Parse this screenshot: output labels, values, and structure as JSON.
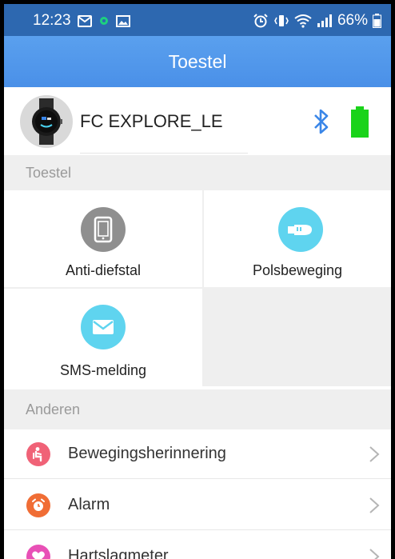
{
  "status_bar": {
    "time": "12:23",
    "battery_percent": "66%"
  },
  "header": {
    "title": "Toestel"
  },
  "device": {
    "name": "FC EXPLORE_LE",
    "bluetooth_icon": "bluetooth-icon",
    "battery_icon": "battery-full-icon",
    "connected_color": "#3a86e8",
    "battery_color": "#1ad31a"
  },
  "sections": {
    "device_label": "Toestel",
    "others_label": "Anderen"
  },
  "tiles": [
    {
      "label": "Anti-diefstal",
      "icon": "phone-icon",
      "color": "#8f8f8f"
    },
    {
      "label": "Polsbeweging",
      "icon": "hand-icon",
      "color": "#5fd4ef"
    },
    {
      "label": "SMS-melding",
      "icon": "envelope-icon",
      "color": "#5fd4ef"
    }
  ],
  "list": [
    {
      "label": "Bewegingsherinnering",
      "icon": "sitting-person-icon",
      "color": "#f06277"
    },
    {
      "label": "Alarm",
      "icon": "alarm-clock-icon",
      "color": "#f06d35"
    },
    {
      "label": "Hartslagmeter",
      "icon": "heart-icon",
      "color": "#e850b6"
    }
  ]
}
